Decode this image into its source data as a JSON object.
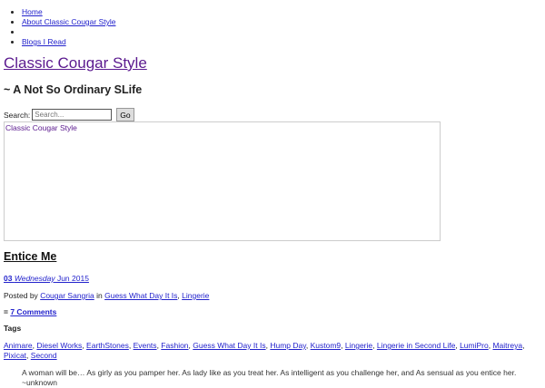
{
  "nav": [
    {
      "label": "Home"
    },
    {
      "label": "About Classic Cougar Style"
    },
    {
      "label": ""
    },
    {
      "label": "Blogs I Read"
    }
  ],
  "site": {
    "title": "Classic Cougar Style",
    "tagline": "~ A Not So Ordinary SLife"
  },
  "search": {
    "label": "Search:",
    "placeholder": "Search...",
    "button": "Go"
  },
  "header_image": {
    "alt": "Classic Cougar Style"
  },
  "post": {
    "title": "Entice Me",
    "date": {
      "day": "03",
      "weekday": "Wednesday",
      "rest": "Jun 2015"
    },
    "posted_by": "Posted by",
    "author": "Cougar Sangria",
    "in": "in",
    "categories": [
      "Guess What Day It Is",
      "Lingerie"
    ],
    "comments_prefix": "=",
    "comments": "7 Comments",
    "tags_label": "Tags",
    "tags": [
      "Animare",
      "Diesel Works",
      "EarthStones",
      "Events",
      "Fashion",
      "Guess What Day It Is",
      "Hump Day",
      "Kustom9",
      "Lingerie",
      "Lingerie in Second Life",
      "LumiPro",
      "Maitreya",
      "Pixicat",
      "Second"
    ],
    "excerpt": "A woman will be… As girly as you pamper her. As lady like as you treat her. As intelligent as you challenge her, and As sensual as you entice her. ~unknown"
  }
}
